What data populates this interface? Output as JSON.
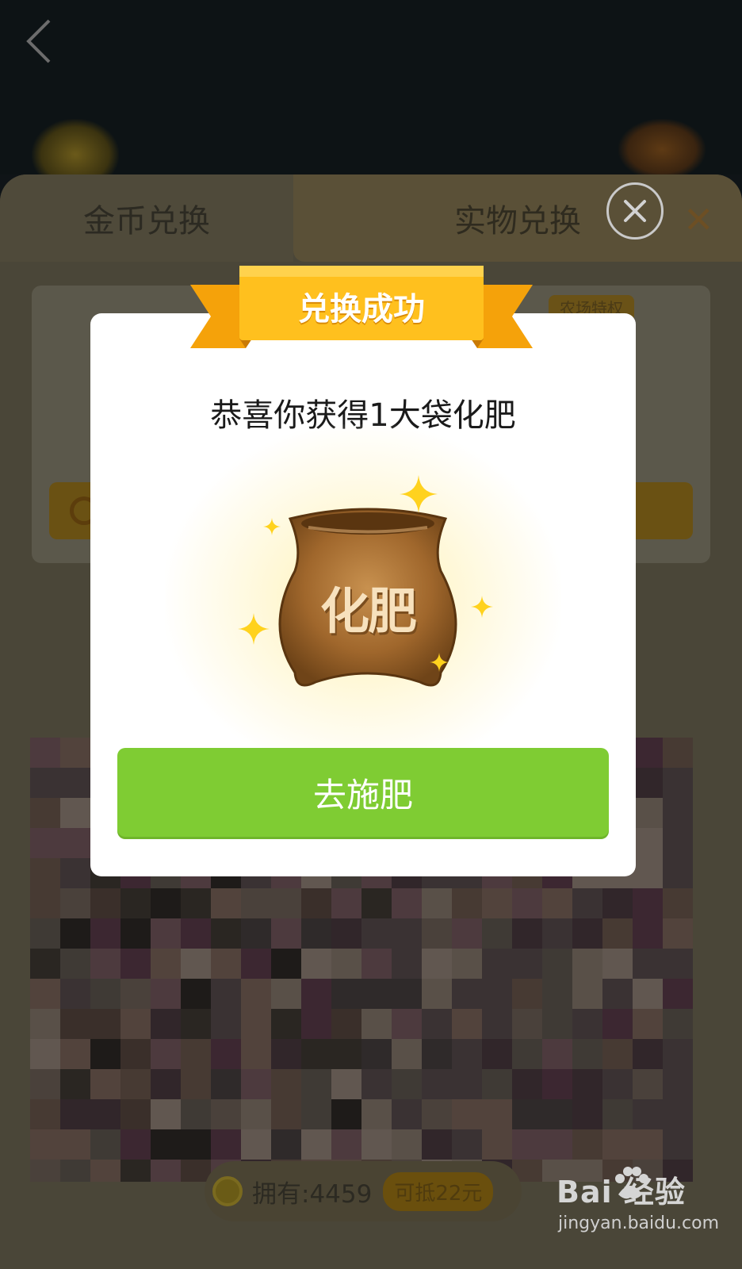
{
  "tabs": [
    {
      "label": "金币兑换"
    },
    {
      "label": "实物兑换"
    }
  ],
  "privilege_badge": "农场特权",
  "footer": {
    "balance": "拥有:4459",
    "discount": "可抵22元"
  },
  "modal": {
    "banner": "兑换成功",
    "message": "恭喜你获得1大袋化肥",
    "item_label": "化肥",
    "action_button": "去施肥"
  },
  "watermark": {
    "logo": "Bai  经验",
    "url": "jingyan.baidu.com"
  },
  "icons": {
    "back": "chevron-left-icon",
    "close": "close-circle-icon",
    "coin": "coin-icon",
    "bag": "fertilizer-bag-icon",
    "sparkle": "sparkle-icon"
  },
  "colors": {
    "action_green": "#7fcc33",
    "ribbon_yellow": "#ffc01e",
    "bag_brown": "#a0672c"
  }
}
